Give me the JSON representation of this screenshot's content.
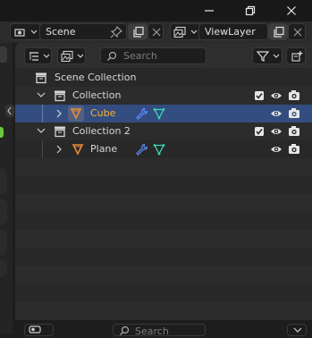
{
  "titlebar": {
    "minimize_icon": "minimize-icon",
    "maximize_icon": "restore-icon",
    "close_icon": "close-icon"
  },
  "topbar": {
    "scene": {
      "value": "Scene",
      "icons": [
        "scene-icon",
        "pin-icon",
        "copy-icon",
        "close-icon"
      ]
    },
    "view_layer": {
      "value": "ViewLayer",
      "icons": [
        "view-layer-icon",
        "copy-icon",
        "close-icon"
      ]
    }
  },
  "outliner": {
    "display_mode_icon": "outliner-display-icon",
    "filter_icon": "filter-icon",
    "search_placeholder": "Search",
    "new_collection_icon": "new-collection-icon",
    "tree": [
      {
        "label": "Scene Collection",
        "type": "scene-collection"
      },
      {
        "label": "Collection",
        "type": "collection",
        "expanded": true,
        "checked": true
      },
      {
        "label": "Cube",
        "type": "mesh-object",
        "selected": true,
        "parent": "Collection"
      },
      {
        "label": "Collection 2",
        "type": "collection",
        "expanded": true,
        "checked": true
      },
      {
        "label": "Plane",
        "type": "mesh-object",
        "selected": false,
        "parent": "Collection 2"
      }
    ]
  },
  "bottom": {
    "search_placeholder": "Search"
  },
  "colors": {
    "selection": "#334d80",
    "selected_text": "#ffaf29",
    "modifier_icon": "#5a8cff",
    "mesh_data_icon": "#3cd5b0",
    "object_icon": "#e88a3a"
  }
}
